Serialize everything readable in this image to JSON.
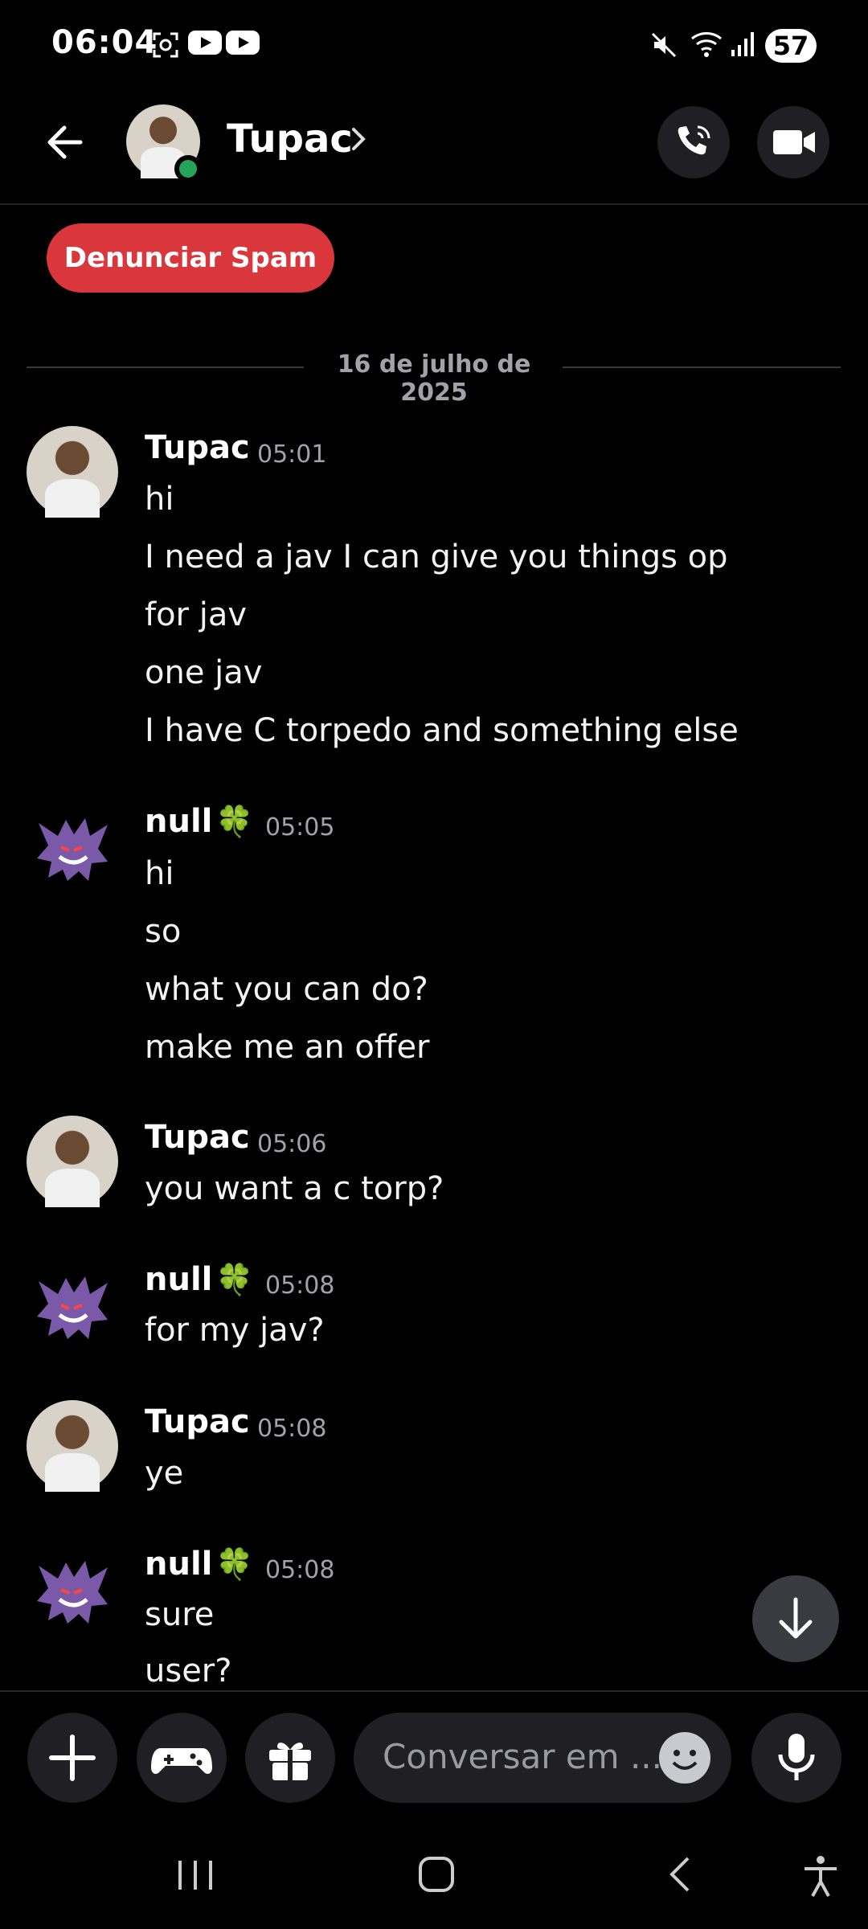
{
  "status_bar": {
    "time": "06:04",
    "battery": "57"
  },
  "header": {
    "contact_name": "Tupac"
  },
  "spam_button": "Denunciar Spam",
  "date_divider": "16 de julho de 2025",
  "messages": [
    {
      "author": "Tupac",
      "time": "05:01",
      "lines": [
        "hi",
        "I need a jav I can give you things op",
        "for jav",
        "one jav",
        "I have C torpedo and something else"
      ]
    },
    {
      "author": "null",
      "author_emoji": "🍀",
      "time": "05:05",
      "lines": [
        "hi",
        "so",
        "what you can do?",
        "make me an offer"
      ]
    },
    {
      "author": "Tupac",
      "time": "05:06",
      "lines": [
        "you want a c torp?"
      ]
    },
    {
      "author": "null",
      "author_emoji": "🍀",
      "time": "05:08",
      "lines": [
        "for my jav?"
      ]
    },
    {
      "author": "Tupac",
      "time": "05:08",
      "lines": [
        "ye"
      ]
    },
    {
      "author": "null",
      "author_emoji": "🍀",
      "time": "05:08",
      "lines": [
        "sure",
        "user?"
      ]
    }
  ],
  "composer": {
    "placeholder": "Conversar em ..."
  },
  "colors": {
    "background": "#000000",
    "spam_red": "#da373c",
    "online_green": "#23a55a",
    "button_bg": "#1f1f24",
    "gengar_purple": "#7a5aa8"
  },
  "icons": [
    "back-arrow-icon",
    "chevron-right-icon",
    "phone-call-icon",
    "video-camera-icon",
    "plus-icon",
    "gamepad-icon",
    "gift-icon",
    "emoji-icon",
    "microphone-icon",
    "arrow-down-icon",
    "recents-icon",
    "home-icon",
    "nav-back-icon",
    "accessibility-icon"
  ]
}
